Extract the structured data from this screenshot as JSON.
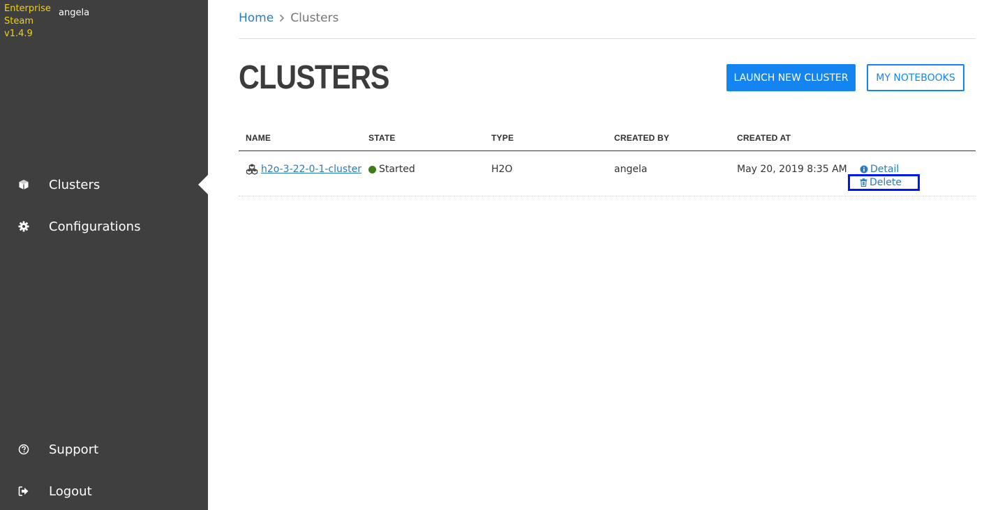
{
  "sidebar": {
    "brand": {
      "line1": "Enterprise",
      "line2": "Steam",
      "version": "v1.4.9"
    },
    "username": "angela",
    "nav_items": [
      {
        "label": "Clusters",
        "icon": "cube-icon",
        "active": true
      },
      {
        "label": "Configurations",
        "icon": "gear-icon",
        "active": false
      },
      {
        "label": "Support",
        "icon": "question-circle-icon",
        "active": false
      },
      {
        "label": "Logout",
        "icon": "sign-out-icon",
        "active": false
      }
    ]
  },
  "breadcrumb": {
    "home": "Home",
    "current": "Clusters"
  },
  "page": {
    "title": "CLUSTERS",
    "launch_button": "LAUNCH NEW CLUSTER",
    "notebooks_button": "MY NOTEBOOKS"
  },
  "table": {
    "headers": [
      "NAME",
      "STATE",
      "TYPE",
      "CREATED BY",
      "CREATED AT"
    ],
    "rows": [
      {
        "name": "h2o-3-22-0-1-cluster",
        "state": "Started",
        "type": "H2O",
        "created_by": "angela",
        "created_at": "May 20, 2019 8:35 AM",
        "actions": {
          "detail": "Detail",
          "delete": "Delete"
        }
      }
    ]
  },
  "colors": {
    "sidebar_bg": "#3f3f3f",
    "brand": "#f2d20a",
    "accent": "#1485f0",
    "link": "#2a7abf",
    "status_started": "#3f7d1a",
    "highlight_box": "#0015ff"
  }
}
